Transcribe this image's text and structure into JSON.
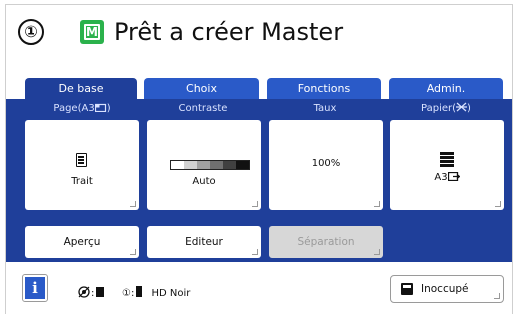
{
  "header": {
    "step_number": "①",
    "master_icon_glyph": "M",
    "master_icon_color": "#2bb24c",
    "title": "Prêt a créer Master"
  },
  "tabs": [
    {
      "label": "De base",
      "active": true
    },
    {
      "label": "Choix",
      "active": false
    },
    {
      "label": "Fonctions",
      "active": false
    },
    {
      "label": "Admin.",
      "active": false
    }
  ],
  "settings": {
    "page": {
      "label": "Page(A3",
      "icon": "paper-orientation-icon",
      "value": "Trait"
    },
    "contrast": {
      "label": "Contraste",
      "value": "Auto",
      "levels": [
        "#ffffff",
        "#d0d0d0",
        "#a0a0a0",
        "#707070",
        "#404040",
        "#111111"
      ]
    },
    "rate": {
      "label": "Taux",
      "value": "100%"
    },
    "paper": {
      "label": "Papier(",
      "icon": "paper-icon",
      "value": "A3"
    }
  },
  "actions": {
    "preview": "Aperçu",
    "editor": "Editeur",
    "separation": "Séparation"
  },
  "footer": {
    "info_label": "i",
    "status_left": ":",
    "status_mid": "①:",
    "ink_label": "HD Noir",
    "idle_label": "Inoccupé"
  },
  "colors": {
    "panel_blue": "#1f3f9a",
    "tab_blue": "#2a5ac8",
    "disabled_grey": "#d7d7d7"
  }
}
